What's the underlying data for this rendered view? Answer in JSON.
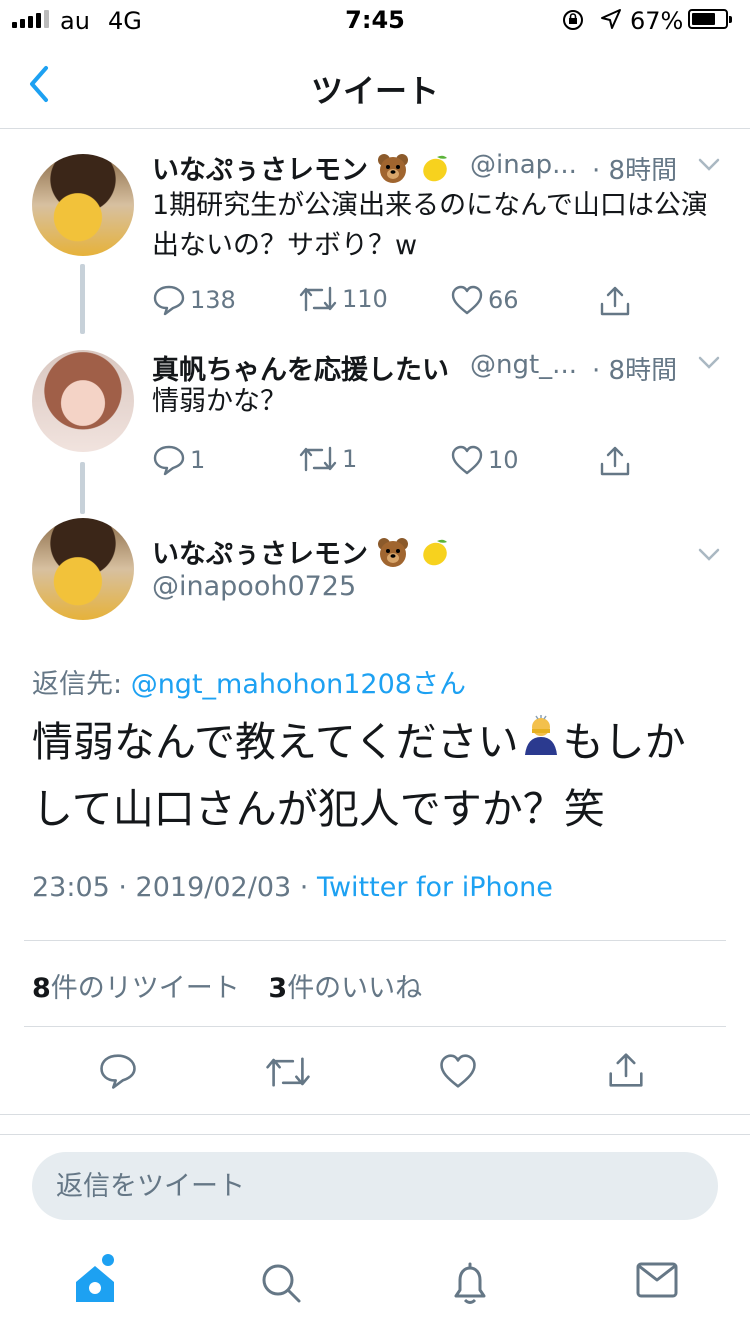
{
  "status_bar": {
    "carrier": "au",
    "network": "4G",
    "time": "7:45",
    "battery_percent": "67%",
    "battery_level": 0.67
  },
  "nav": {
    "title": "ツイート"
  },
  "tweets": [
    {
      "display_name": "いなぷぅさレモン",
      "handle": "@inap...",
      "time": "· 8時間",
      "text": "1期研究生が公演出来るのになんで山口は公演出ないの？サボり？w",
      "replies": "138",
      "retweets": "110",
      "likes": "66"
    },
    {
      "display_name": "真帆ちゃんを応援したい",
      "handle": "@ngt_...",
      "time": "· 8時間",
      "text": "情弱かな？",
      "replies": "1",
      "retweets": "1",
      "likes": "10"
    }
  ],
  "main_tweet": {
    "display_name": "いなぷぅさレモン",
    "handle": "@inapooh0725",
    "reply_to_label": "返信先: ",
    "reply_to_user": "@ngt_mahohon1208さん",
    "text_part1": "情弱なんで教えてください",
    "text_part2": "もしかして山口さんが犯人ですか？笑",
    "timestamp": "23:05 · 2019/02/03 · ",
    "source": "Twitter for iPhone",
    "retweet_count": "8",
    "retweet_label": "件のリツイート",
    "like_count": "3",
    "like_label": "件のいいね"
  },
  "reply_box": {
    "placeholder": "返信をツイート"
  },
  "colors": {
    "accent": "#1da1f2",
    "secondary_text": "#657786",
    "divider": "#d9dde1"
  },
  "icons": [
    "back-chevron-icon",
    "reply-icon",
    "retweet-icon",
    "like-icon",
    "share-icon",
    "home-icon",
    "search-icon",
    "notifications-icon",
    "messages-icon",
    "bear-emoji-icon",
    "lemon-emoji-icon",
    "bowing-person-emoji-icon"
  ]
}
